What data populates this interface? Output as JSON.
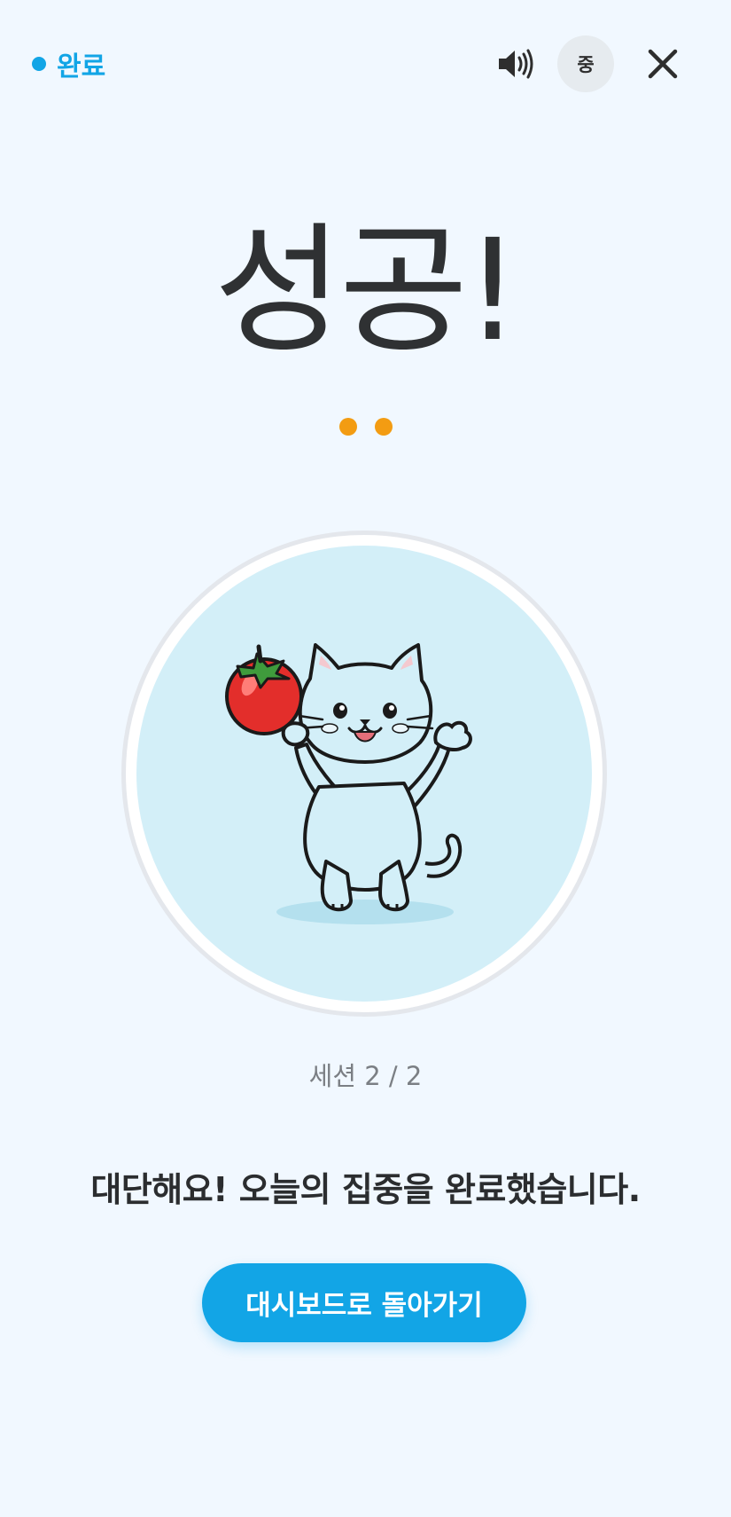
{
  "status": {
    "label": "완료",
    "color": "#12a5e6"
  },
  "header": {
    "level_label": "중",
    "sound_icon": "speaker-icon",
    "close_icon": "close-icon"
  },
  "main": {
    "title": "성공!",
    "progress_dots": 2,
    "illustration": "cat-holding-tomato",
    "session_text": "세션 2 / 2",
    "message": "대단해요! 오늘의 집중을 완료했습니다.",
    "cta_label": "대시보드로 돌아가기"
  },
  "colors": {
    "accent": "#12a5e6",
    "dot": "#f39c12",
    "background": "#f1f8ff",
    "circle_fill": "#d3eff8"
  }
}
